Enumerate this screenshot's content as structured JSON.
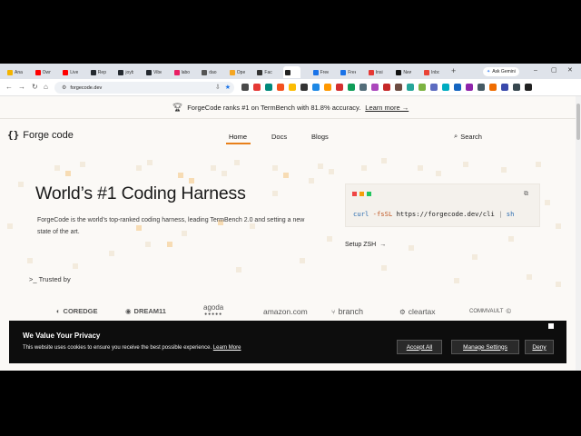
{
  "browser": {
    "tabs": [
      {
        "label": "Anal",
        "color": "#f4b400",
        "icon": "analytics-icon"
      },
      {
        "label": "Own",
        "color": "#ff0000",
        "icon": "youtube-icon"
      },
      {
        "label": "Live",
        "color": "#ff0000",
        "icon": "youtube-icon"
      },
      {
        "label": "Rep",
        "color": "#24292f",
        "icon": "github-icon"
      },
      {
        "label": "joyb",
        "color": "#24292f",
        "icon": "github-icon"
      },
      {
        "label": "Vibe",
        "color": "#24292f",
        "icon": "github-icon"
      },
      {
        "label": "labo",
        "color": "#e91e63",
        "icon": "app-icon"
      },
      {
        "label": "dao",
        "color": "#555555",
        "icon": "page-icon"
      },
      {
        "label": "Ope",
        "color": "#f5a623",
        "icon": "page-icon"
      },
      {
        "label": "Fact",
        "color": "#333333",
        "icon": "page-icon"
      },
      {
        "label": "",
        "color": "#222222",
        "icon": "forgecode-icon"
      },
      {
        "label": "Free",
        "color": "#1a73e8",
        "icon": "globe-icon"
      },
      {
        "label": "Free",
        "color": "#1a73e8",
        "icon": "globe-icon"
      },
      {
        "label": "Insi",
        "color": "#e53935",
        "icon": "page-icon"
      },
      {
        "label": "New",
        "color": "#111111",
        "icon": "page-icon"
      },
      {
        "label": "Inbo",
        "color": "#ea4335",
        "icon": "gmail-icon"
      }
    ],
    "new_tab": "+",
    "ask_gemini": "Ask Gemini",
    "url": "forgecode.dev",
    "extensions": [
      "#4a4a4a",
      "#e53935",
      "#00897b",
      "#f4511e",
      "#fbbc04",
      "#333333",
      "#1e88e5",
      "#ff9800",
      "#d32f2f",
      "#0f9d58",
      "#546e7a",
      "#ab47bc",
      "#c62828",
      "#6d4c41",
      "#26a69a",
      "#7cb342",
      "#5c6bc0",
      "#00acc1",
      "#1565c0",
      "#8e24aa",
      "#455a64",
      "#ef6c00",
      "#3949ab",
      "#37474f",
      "#212121"
    ]
  },
  "banner": {
    "text": "ForgeCode ranks #1 on TermBench with 81.8% accuracy.",
    "link": "Learn more →"
  },
  "nav": {
    "logo_mark": "{}",
    "logo_text": "Forge code",
    "home": "Home",
    "docs": "Docs",
    "blogs": "Blogs",
    "search": "Search",
    "accent": "#e8801a"
  },
  "hero": {
    "title": "World’s #1 Coding Harness",
    "description": "ForgeCode is the world’s top-ranked coding harness, leading TermBench 2.0 and setting a new state of the art.",
    "command": "curl -fsSL https://forgecode.dev/cli | sh",
    "setup": "Setup ZSH",
    "setup_arrow": "→",
    "dots": [
      "#ef4444",
      "#f59e0b",
      "#22c55e"
    ]
  },
  "trusted": {
    "prefix": ">_",
    "label": "Trusted by",
    "brands": [
      "COREDGE",
      "DREAM11",
      "agoda",
      "amazon.com",
      "branch",
      "cleartax",
      "COMMVAULT"
    ]
  },
  "cookie": {
    "title": "We Value Your Privacy",
    "text": "This website uses cookies to ensure you receive the best possible experience.",
    "learn_more": "Learn More",
    "accept": "Accept All",
    "manage": "Manage Settings",
    "deny": "Deny"
  }
}
